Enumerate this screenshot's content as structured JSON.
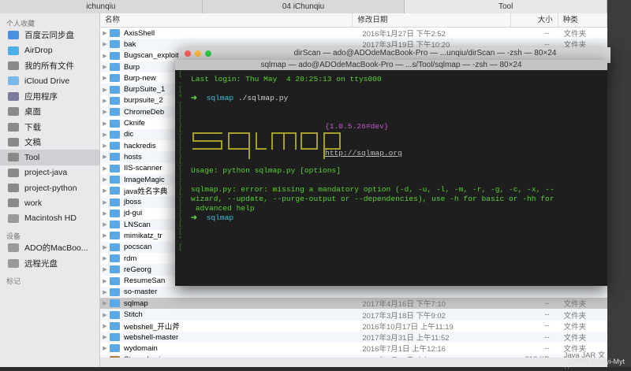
{
  "tabs": [
    "ichunqiu",
    "04 iChunqiu",
    "Tool"
  ],
  "sidebar": {
    "favorites_header": "个人收藏",
    "items": [
      {
        "label": "百度云同步盘",
        "icon": "cloud-icon",
        "color": "#4a90e2"
      },
      {
        "label": "AirDrop",
        "icon": "airdrop-icon",
        "color": "#4ab0e8"
      },
      {
        "label": "我的所有文件",
        "icon": "all-files-icon",
        "color": "#8a8a8a"
      },
      {
        "label": "iCloud Drive",
        "icon": "icloud-icon",
        "color": "#7ab8ea"
      },
      {
        "label": "应用程序",
        "icon": "applications-icon",
        "color": "#7a7a9a"
      },
      {
        "label": "桌面",
        "icon": "desktop-icon",
        "color": "#8a8a8a"
      },
      {
        "label": "下载",
        "icon": "downloads-icon",
        "color": "#8a8a8a"
      },
      {
        "label": "文稿",
        "icon": "documents-icon",
        "color": "#8a8a8a"
      },
      {
        "label": "Tool",
        "icon": "folder-icon",
        "color": "#8a8a8a",
        "selected": true
      },
      {
        "label": "project-java",
        "icon": "folder-icon",
        "color": "#8a8a8a"
      },
      {
        "label": "project-python",
        "icon": "folder-icon",
        "color": "#8a8a8a"
      },
      {
        "label": "work",
        "icon": "folder-icon",
        "color": "#8a8a8a"
      },
      {
        "label": "Macintosh HD",
        "icon": "disk-icon",
        "color": "#9a9a9a"
      }
    ],
    "devices_header": "设备",
    "devices": [
      {
        "label": "ADO的MacBoo...",
        "icon": "laptop-icon",
        "color": "#9a9a9a"
      },
      {
        "label": "远程光盘",
        "icon": "remote-disc-icon",
        "color": "#9a9a9a"
      }
    ],
    "tags_header": "标记"
  },
  "columns": {
    "name": "名称",
    "date": "修改日期",
    "size": "大小",
    "kind": "种类"
  },
  "files": [
    {
      "name": "AxisShell",
      "date": "2016年1月27日 下午2:52",
      "size": "--",
      "kind": "文件夹"
    },
    {
      "name": "bak",
      "date": "2017年3月19日 下午10:20",
      "size": "--",
      "kind": "文件夹"
    },
    {
      "name": "Bugscan_exploits",
      "date": "",
      "size": "--",
      "kind": "文件夹"
    },
    {
      "name": "Burp",
      "date": "",
      "size": "",
      "kind": ""
    },
    {
      "name": "Burp-new",
      "date": "",
      "size": "",
      "kind": ""
    },
    {
      "name": "BurpSuite_1",
      "date": "",
      "size": "",
      "kind": ""
    },
    {
      "name": "burpsuite_2",
      "date": "",
      "size": "",
      "kind": ""
    },
    {
      "name": "ChromeDeb",
      "date": "",
      "size": "",
      "kind": ""
    },
    {
      "name": "Cknife",
      "date": "",
      "size": "",
      "kind": ""
    },
    {
      "name": "dic",
      "date": "",
      "size": "",
      "kind": ""
    },
    {
      "name": "hackredis",
      "date": "",
      "size": "",
      "kind": ""
    },
    {
      "name": "hosts",
      "date": "",
      "size": "",
      "kind": ""
    },
    {
      "name": "IIS-scanner",
      "date": "",
      "size": "",
      "kind": ""
    },
    {
      "name": "ImageMagic",
      "date": "",
      "size": "",
      "kind": ""
    },
    {
      "name": "java姓名字典",
      "date": "",
      "size": "",
      "kind": ""
    },
    {
      "name": "jboss",
      "date": "",
      "size": "",
      "kind": ""
    },
    {
      "name": "jd-gui",
      "date": "",
      "size": "",
      "kind": ""
    },
    {
      "name": "LNScan",
      "date": "",
      "size": "",
      "kind": ""
    },
    {
      "name": "mimikatz_tr",
      "date": "",
      "size": "",
      "kind": ""
    },
    {
      "name": "pocscan",
      "date": "",
      "size": "",
      "kind": ""
    },
    {
      "name": "rdm",
      "date": "",
      "size": "",
      "kind": ""
    },
    {
      "name": "reGeorg",
      "date": "",
      "size": "",
      "kind": ""
    },
    {
      "name": "ResumeSan",
      "date": "",
      "size": "",
      "kind": ""
    },
    {
      "name": "so-master",
      "date": "",
      "size": "",
      "kind": ""
    },
    {
      "name": "sqlmap",
      "date": "2017年4月16日 下午7:10",
      "size": "--",
      "kind": "文件夹",
      "selected": true
    },
    {
      "name": "Stitch",
      "date": "2017年3月18日 下午9:02",
      "size": "--",
      "kind": "文件夹"
    },
    {
      "name": "webshell_开山斧",
      "date": "2016年10月17日 上午11:19",
      "size": "--",
      "kind": "文件夹"
    },
    {
      "name": "webshell-master",
      "date": "2017年3月31日 上午11:52",
      "size": "--",
      "kind": "文件夹"
    },
    {
      "name": "wydomain",
      "date": "2016年7月1日 上午12:16",
      "size": "--",
      "kind": "文件夹"
    },
    {
      "name": "Stegsolve.jar",
      "date": "2017年3月29日 上午10:00",
      "size": "312 KB",
      "kind": "Java JAR 文件",
      "jar": true
    }
  ],
  "terminal": {
    "outer_title": "dirScan — ado@ADOdeMacBook-Pro — ...unqiu/dirScan — -zsh — 80×24",
    "title": "sqlmap — ado@ADOdeMacBook-Pro — ...s/Tool/sqlmap — -zsh — 80×24",
    "last_login": "Last login: Thu May  4 20:25:13 on ttys000",
    "prompt_symbol": "➜",
    "cwd1": "sqlmap",
    "command1": "./sqlmap.py",
    "version": "{1.0.5.26#dev}",
    "url": "http://sqlmap.org",
    "usage": "Usage: python sqlmap.py [options]",
    "error1": "sqlmap.py: error: missing a mandatory option (-d, -u, -l, -m, -r, -g, -c, -x, --",
    "error2": "wizard, --update, --purge-output or --dependencies), use -h for basic or -hh for",
    "error3": " advanced help",
    "cwd2": "sqlmap"
  },
  "watermark": "CSDN @anyi-Myt"
}
